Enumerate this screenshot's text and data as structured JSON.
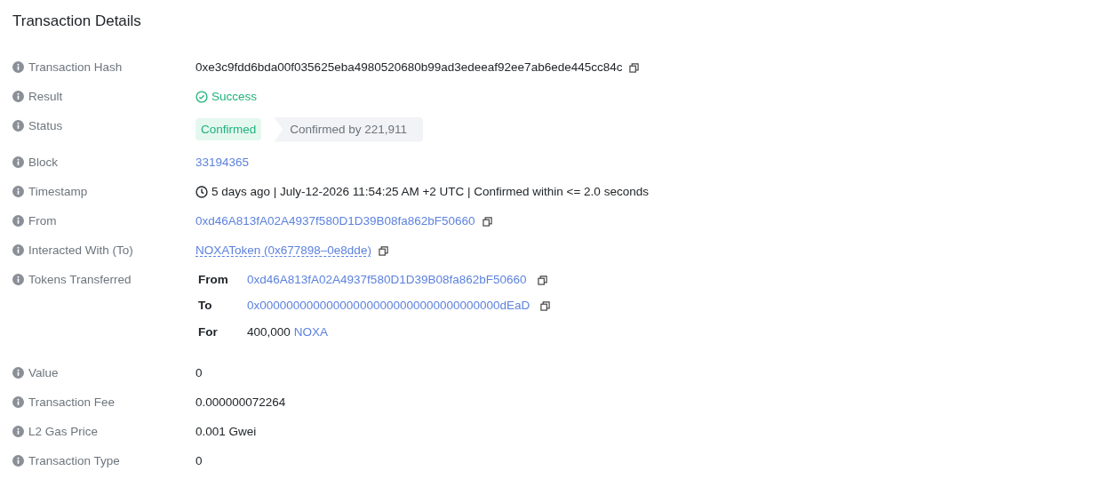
{
  "title": "Transaction Details",
  "rows": [
    {
      "label": "Transaction Hash",
      "kind": "text",
      "value": "0xe3c9fdd6bda00f035625eba4980520680b99ad3edeeaf92ee7ab6ede445cc84c",
      "copy": true
    },
    {
      "label": "Result",
      "kind": "result",
      "value": "Success"
    },
    {
      "label": "Status",
      "kind": "status",
      "badge": "Confirmed",
      "detail": "Confirmed by 221,911"
    },
    {
      "label": "Block",
      "kind": "link",
      "value": "33194365"
    },
    {
      "label": "Timestamp",
      "kind": "timestamp",
      "value": "5 days ago | July-12-2026 11:54:25 AM +2 UTC | Confirmed within <= 2.0 seconds"
    },
    {
      "label": "From",
      "kind": "link",
      "value": "0xd46A813fA02A4937f580D1D39B08fa862bF50660",
      "copy": true
    },
    {
      "label": "Interacted With (To)",
      "kind": "contract",
      "value": "NOXAToken (0x677898–0e8dde)",
      "copy": true
    },
    {
      "label": "Tokens Transferred",
      "kind": "transfers",
      "transfers": [
        {
          "label": "From",
          "value": "0xd46A813fA02A4937f580D1D39B08fa862bF50660",
          "copy": true
        },
        {
          "label": "To",
          "value": "0x000000000000000000000000000000000000dEaD",
          "copy": true
        },
        {
          "label": "For",
          "amount": "400,000",
          "token": "NOXA"
        }
      ]
    },
    {
      "label": "Value",
      "kind": "text",
      "value": "0"
    },
    {
      "label": "Transaction Fee",
      "kind": "text",
      "value": "0.000000072264"
    },
    {
      "label": "L2 Gas Price",
      "kind": "text",
      "value": "0.001 Gwei"
    },
    {
      "label": "Transaction Type",
      "kind": "text",
      "value": "0"
    }
  ]
}
